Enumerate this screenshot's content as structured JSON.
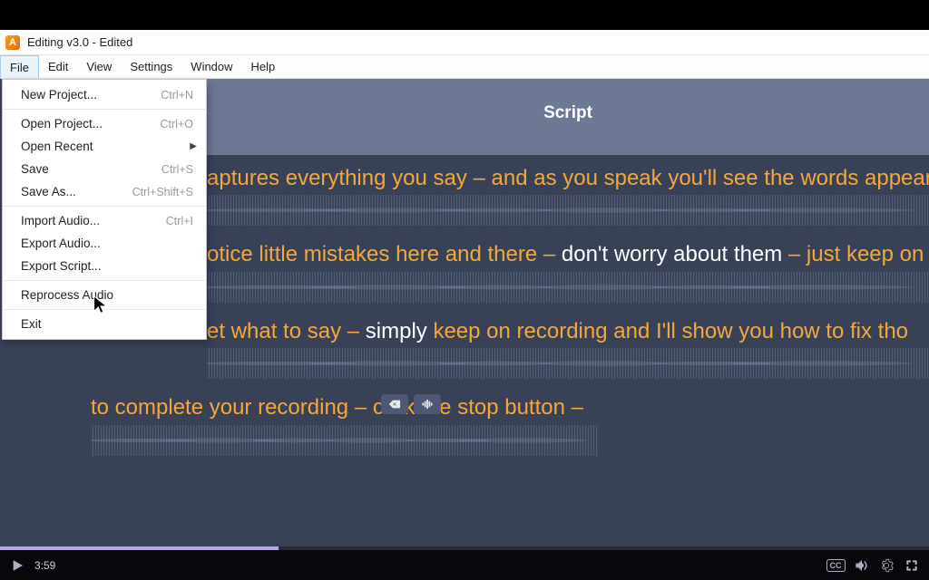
{
  "player": {
    "time": "3:59"
  },
  "window": {
    "title": "Editing v3.0 - Edited",
    "app_icon_letter": "A"
  },
  "menubar": [
    "File",
    "Edit",
    "View",
    "Settings",
    "Window",
    "Help"
  ],
  "file_menu": {
    "new_project": "New Project...",
    "new_project_sc": "Ctrl+N",
    "open_project": "Open Project...",
    "open_project_sc": "Ctrl+O",
    "open_recent": "Open Recent",
    "save": "Save",
    "save_sc": "Ctrl+S",
    "save_as": "Save As...",
    "save_as_sc": "Ctrl+Shift+S",
    "import_audio": "Import Audio...",
    "import_audio_sc": "Ctrl+I",
    "export_audio": "Export Audio...",
    "export_script": "Export Script...",
    "reprocess_audio": "Reprocess Audio",
    "exit": "Exit"
  },
  "header": {
    "tab": "Script"
  },
  "script": {
    "line1_a": "aptures everything you say – and as you speak you'll see the words appear",
    "line2_a": "otice little mistakes here and there – ",
    "line2_b": "don't worry about them",
    "line2_c": " – just keep on",
    "line3_a": "et what to say – ",
    "line3_b": "simply",
    "line3_c": " keep on recording and I'll show you how to fix tho",
    "line4": "to complete your recording – click the stop button –"
  }
}
